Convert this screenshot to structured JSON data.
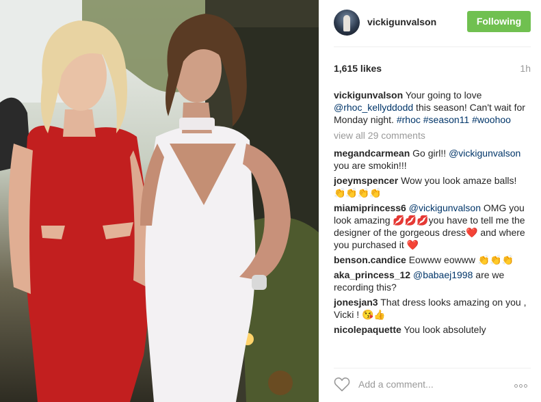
{
  "photo": {
    "icon": "post-photo"
  },
  "post": {
    "username": "vickigunvalson",
    "follow_label": "Following",
    "likes": "1,615 likes",
    "time": "1h",
    "caption": {
      "user": "vickigunvalson",
      "text_1": "Your going to love ",
      "mention": "@rhoc_kellyddodd",
      "text_2": " this season! Can't wait for Monday night. ",
      "tags": "#rhoc #season11 #woohoo"
    },
    "view_all": "view all 29 comments",
    "comments": [
      {
        "user": "megandcarmean",
        "pre": "Go girl!! ",
        "mention": "@vickigunvalson",
        "post": " you are smokin!!!"
      },
      {
        "user": "joeymspencer",
        "pre": "Wow you look amaze balls! 👏👏👏👏",
        "mention": "",
        "post": ""
      },
      {
        "user": "miamiprincess6",
        "pre": "",
        "mention": "@vickigunvalson",
        "post": " OMG you look amazing 💋💋💋you have to tell me the designer of the gorgeous dress❤️ and where you purchased it ❤️"
      },
      {
        "user": "benson.candice",
        "pre": "Eowww eowww 👏👏👏",
        "mention": "",
        "post": ""
      },
      {
        "user": "aka_princess_12",
        "pre": "",
        "mention": "@babaej1998",
        "post": " are we recording this?"
      },
      {
        "user": "jonesjan3",
        "pre": "That dress looks amazing on you , Vicki ! 😘👍",
        "mention": "",
        "post": ""
      },
      {
        "user": "nicolepaquette",
        "pre": "You look absolutely",
        "mention": "",
        "post": ""
      }
    ],
    "comment_placeholder": "Add a comment..."
  },
  "colors": {
    "follow_button": "#70c050",
    "link": "#003569",
    "muted": "#999999"
  },
  "icons": {
    "heart": "heart-outline-icon",
    "more": "more-options-icon"
  }
}
